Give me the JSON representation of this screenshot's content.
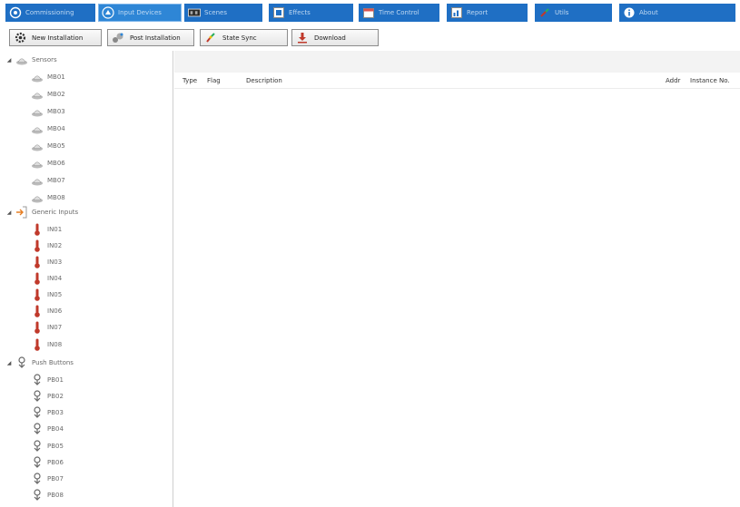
{
  "tabs": [
    {
      "label": "Commissioning",
      "icon": "target-icon"
    },
    {
      "label": "Input Devices",
      "icon": "input-devices-icon"
    },
    {
      "label": "Scenes",
      "icon": "scenes-icon"
    },
    {
      "label": "Effects",
      "icon": "effects-icon"
    },
    {
      "label": "Time Control",
      "icon": "calendar-icon"
    },
    {
      "label": "Report",
      "icon": "report-icon"
    },
    {
      "label": "Utils",
      "icon": "utils-icon"
    },
    {
      "label": "About",
      "icon": "info-icon"
    }
  ],
  "toolbar": {
    "new_installation": "New Installation",
    "post_installation": "Post Installation",
    "state_sync": "State Sync",
    "download": "Download"
  },
  "tree": {
    "sensors": {
      "label": "Sensors",
      "items": [
        "MB01",
        "MB02",
        "MB03",
        "MB04",
        "MB05",
        "MB06",
        "MB07",
        "MB08"
      ]
    },
    "generic_inputs": {
      "label": "Generic Inputs",
      "items": [
        "IN01",
        "IN02",
        "IN03",
        "IN04",
        "IN05",
        "IN06",
        "IN07",
        "IN08"
      ]
    },
    "push_buttons": {
      "label": "Push Buttons",
      "items": [
        "PB01",
        "PB02",
        "PB03",
        "PB04",
        "PB05",
        "PB06",
        "PB07",
        "PB08"
      ]
    }
  },
  "table": {
    "columns": {
      "type": "Type",
      "flag": "Flag",
      "description": "Description",
      "addr": "Addr",
      "instance_no": "Instance No."
    }
  },
  "colors": {
    "tab_bg": "#1f6fc4",
    "tab_active": "#2e86d6",
    "accent_red": "#c0392b"
  }
}
